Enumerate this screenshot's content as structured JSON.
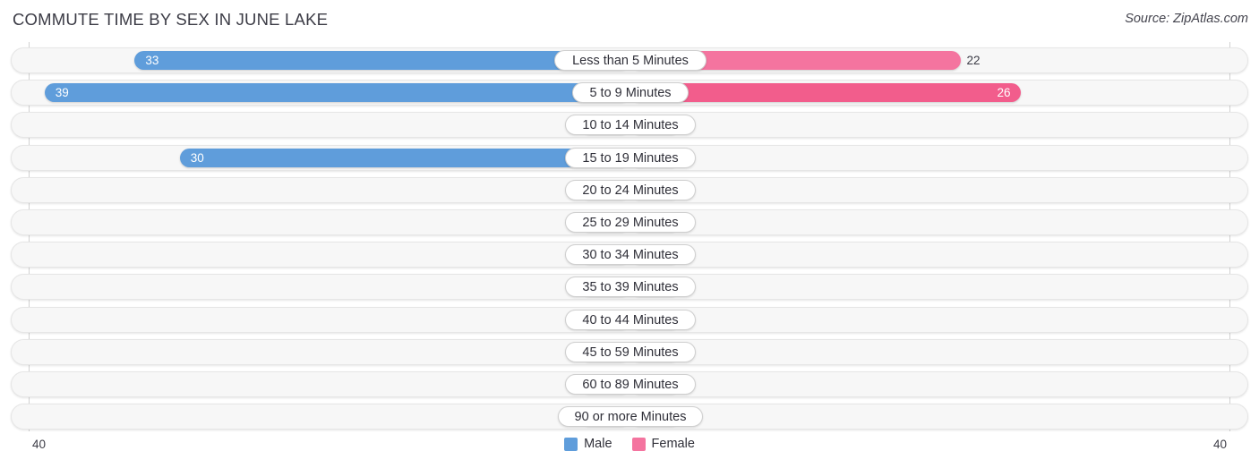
{
  "header": {
    "title": "COMMUTE TIME BY SEX IN JUNE LAKE",
    "source": "Source: ZipAtlas.com"
  },
  "axis": {
    "left_tick": "40",
    "right_tick": "40",
    "max": 40
  },
  "legend": [
    {
      "label": "Male",
      "color": "#5f9ddb",
      "icon": "male-legend-swatch"
    },
    {
      "label": "Female",
      "color": "#f4749f",
      "icon": "female-legend-swatch"
    }
  ],
  "chart_data": {
    "type": "bar",
    "title": "COMMUTE TIME BY SEX IN JUNE LAKE",
    "subtitle": "Source: ZipAtlas.com",
    "orientation": "horizontal-diverging",
    "xlabel": "",
    "ylabel": "",
    "xlim": [
      -40,
      40
    ],
    "axis_max": 40,
    "grid": false,
    "legend_position": "bottom-center",
    "categories": [
      "Less than 5 Minutes",
      "5 to 9 Minutes",
      "10 to 14 Minutes",
      "15 to 19 Minutes",
      "20 to 24 Minutes",
      "25 to 29 Minutes",
      "30 to 34 Minutes",
      "35 to 39 Minutes",
      "40 to 44 Minutes",
      "45 to 59 Minutes",
      "60 to 89 Minutes",
      "90 or more Minutes"
    ],
    "series": [
      {
        "name": "Male",
        "color": "#5f9ddb",
        "values": [
          33,
          39,
          0,
          30,
          0,
          0,
          0,
          0,
          0,
          0,
          0,
          0
        ],
        "labels": [
          "33",
          "39",
          "0",
          "30",
          "0",
          "0",
          "0",
          "0",
          "0",
          "0",
          "0",
          "0"
        ]
      },
      {
        "name": "Female",
        "color": "#f4749f",
        "values": [
          22,
          26,
          0,
          0,
          0,
          0,
          0,
          0,
          0,
          0,
          0,
          0
        ],
        "labels": [
          "22",
          "26",
          "0",
          "0",
          "0",
          "0",
          "0",
          "0",
          "0",
          "0",
          "0",
          "0"
        ]
      }
    ]
  },
  "rows": [
    {
      "label": "Less than 5 Minutes",
      "male": "33",
      "female": "22",
      "male_inside": true,
      "female_inside": false,
      "female_strong": false
    },
    {
      "label": "5 to 9 Minutes",
      "male": "39",
      "female": "26",
      "male_inside": true,
      "female_inside": true,
      "female_strong": true
    },
    {
      "label": "10 to 14 Minutes",
      "male": "0",
      "female": "0",
      "male_inside": false,
      "female_inside": false,
      "female_strong": false
    },
    {
      "label": "15 to 19 Minutes",
      "male": "30",
      "female": "0",
      "male_inside": true,
      "female_inside": false,
      "female_strong": false
    },
    {
      "label": "20 to 24 Minutes",
      "male": "0",
      "female": "0",
      "male_inside": false,
      "female_inside": false,
      "female_strong": false
    },
    {
      "label": "25 to 29 Minutes",
      "male": "0",
      "female": "0",
      "male_inside": false,
      "female_inside": false,
      "female_strong": false
    },
    {
      "label": "30 to 34 Minutes",
      "male": "0",
      "female": "0",
      "male_inside": false,
      "female_inside": false,
      "female_strong": false
    },
    {
      "label": "35 to 39 Minutes",
      "male": "0",
      "female": "0",
      "male_inside": false,
      "female_inside": false,
      "female_strong": false
    },
    {
      "label": "40 to 44 Minutes",
      "male": "0",
      "female": "0",
      "male_inside": false,
      "female_inside": false,
      "female_strong": false
    },
    {
      "label": "45 to 59 Minutes",
      "male": "0",
      "female": "0",
      "male_inside": false,
      "female_inside": false,
      "female_strong": false
    },
    {
      "label": "60 to 89 Minutes",
      "male": "0",
      "female": "0",
      "male_inside": false,
      "female_inside": false,
      "female_strong": false
    },
    {
      "label": "90 or more Minutes",
      "male": "0",
      "female": "0",
      "male_inside": false,
      "female_inside": false,
      "female_strong": false
    }
  ]
}
